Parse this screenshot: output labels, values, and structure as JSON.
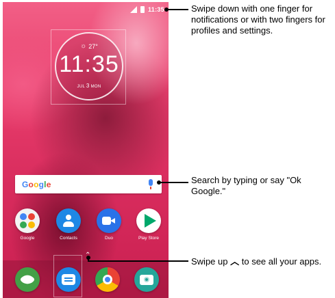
{
  "status_bar": {
    "time": "11:35"
  },
  "clock_widget": {
    "weather": "27°",
    "time": "11:35",
    "date_month": "JUL",
    "date_day": "3",
    "date_weekday": "MON"
  },
  "search": {
    "logo": "Google"
  },
  "apps": [
    {
      "label": "Google"
    },
    {
      "label": "Contacts"
    },
    {
      "label": "Duo"
    },
    {
      "label": "Play Store"
    }
  ],
  "dock": [
    "phone-icon",
    "messages-icon",
    "chrome-icon",
    "camera-icon"
  ],
  "callouts": {
    "status": "Swipe down with one finger for notifications or with two fingers for profiles and settings.",
    "search": "Search by typing or say \"Ok Google.\"",
    "swipe_prefix": "Swipe up",
    "swipe_suffix": "to see all your apps."
  },
  "colors": {
    "wallpaper": "#e63b6a",
    "google_blue": "#4285f4",
    "google_red": "#ea4335",
    "google_yellow": "#fbbc05",
    "google_green": "#34a853"
  }
}
